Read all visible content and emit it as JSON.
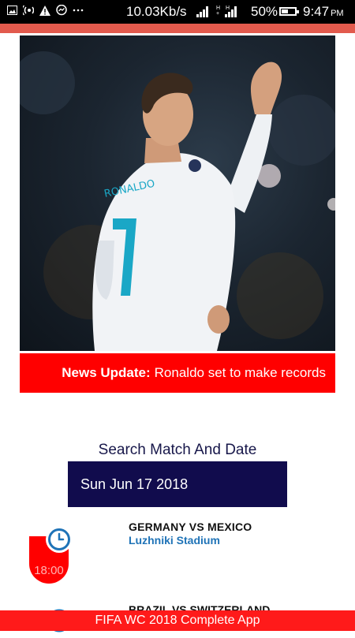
{
  "status_bar": {
    "speed": "10.03Kb/s",
    "battery": "50%",
    "time": "9:47",
    "ampm": "PM",
    "icons": [
      "image-icon",
      "hotspot-icon",
      "warning-icon",
      "messenger-icon",
      "more-icon"
    ]
  },
  "news": {
    "label": "News Update:",
    "text": "Ronaldo set to make records"
  },
  "search": {
    "title": "Search Match And Date",
    "date": "Sun Jun 17 2018"
  },
  "matches": [
    {
      "teams": "GERMANY VS MEXICO",
      "venue": "Luzhniki Stadium",
      "time": "18:00"
    },
    {
      "teams": "BRAZIL VS SWITZERLAND",
      "venue": "",
      "time": ""
    }
  ],
  "footer": {
    "title": "FIFA WC 2018 Complete App"
  },
  "colors": {
    "accent_red": "#ff0000",
    "navy": "#110c4d",
    "venue_blue": "#1f73b7",
    "top_band": "#e25a4d"
  }
}
